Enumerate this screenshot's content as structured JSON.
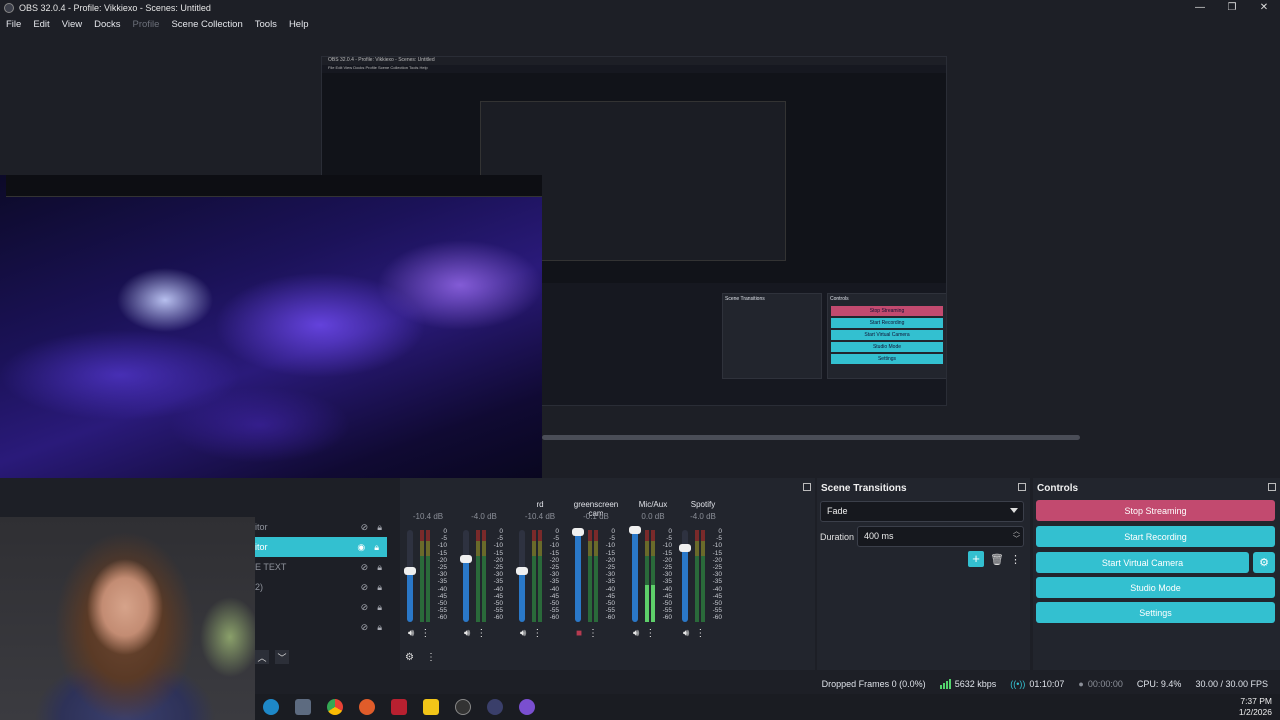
{
  "window": {
    "title": "OBS 32.0.4 - Profile: Vikkiexo - Scenes: Untitled",
    "controls": [
      "—",
      "❐",
      "✕"
    ]
  },
  "menu": [
    "File",
    "Edit",
    "View",
    "Docks",
    "Profile",
    "Scene Collection",
    "Tools",
    "Help"
  ],
  "nested": {
    "title": "OBS 32.0.4 - Profile: Vikkiexo - Scenes: Untitled",
    "buttons": [
      "Stop Streaming",
      "Start Recording",
      "Start Virtual Camera",
      "Studio Mode",
      "Settings"
    ],
    "transitions_title": "Scene Transitions",
    "controls_title": "Controls"
  },
  "sources": {
    "items": [
      {
        "label": "itor"
      },
      {
        "label": "itor"
      },
      {
        "label": "E TEXT"
      },
      {
        "label": "2)"
      },
      {
        "label": ""
      },
      {
        "label": ""
      }
    ]
  },
  "mixer": {
    "channels": [
      {
        "name": "",
        "db": "-10.4 dB",
        "level": 0.55,
        "meter_active": false
      },
      {
        "name": "",
        "db": "-4.0 dB",
        "level": 0.68,
        "meter_active": false
      },
      {
        "name": "rd",
        "db": "-10.4 dB",
        "level": 0.55,
        "meter_active": false
      },
      {
        "name": "greenscreen cam",
        "db": "-0.1 dB",
        "level": 0.98,
        "meter_active": false,
        "muted": true
      },
      {
        "name": "Mic/Aux",
        "db": "0.0 dB",
        "level": 1.0,
        "meter_active": true
      },
      {
        "name": "Spotify",
        "db": "-4.0 dB",
        "level": 0.8,
        "meter_active": false
      }
    ],
    "scale": [
      "0",
      "-5",
      "-10",
      "-15",
      "-20",
      "-25",
      "-30",
      "-35",
      "-40",
      "-45",
      "-50",
      "-55",
      "-60"
    ]
  },
  "transitions": {
    "title": "Scene Transitions",
    "selected": "Fade",
    "duration_label": "Duration",
    "duration_value": "400 ms"
  },
  "controls": {
    "title": "Controls",
    "stop_streaming": "Stop Streaming",
    "start_recording": "Start Recording",
    "start_virtual_camera": "Start Virtual Camera",
    "studio_mode": "Studio Mode",
    "settings": "Settings"
  },
  "status": {
    "dropped_frames": "Dropped Frames 0 (0.0%)",
    "bitrate": "5632 kbps",
    "stream_time": "01:10:07",
    "record_time": "00:00:00",
    "cpu": "CPU: 9.4%",
    "fps": "30.00 / 30.00 FPS"
  },
  "clock": {
    "time": "7:37 PM",
    "date": "1/2/2026"
  },
  "colors": {
    "accent": "#33c0d0",
    "stop": "#c24a6f",
    "panel": "#22252d",
    "bg": "#1d1f26"
  }
}
